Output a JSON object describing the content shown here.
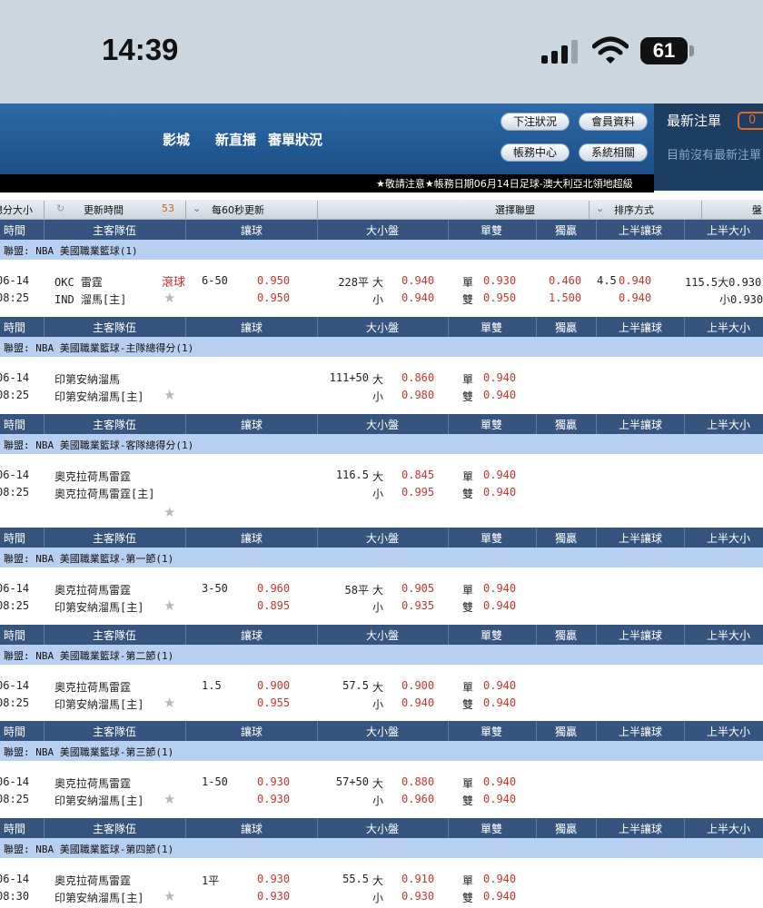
{
  "status_bar": {
    "time": "14:39",
    "battery": "61",
    "signal_icon": "cellular-signal-icon",
    "wifi_icon": "wifi-icon"
  },
  "header": {
    "nav": [
      "影城",
      "新直播",
      "審單狀況"
    ],
    "buttons": {
      "bet_status": "下注狀況",
      "member_info": "會員資料",
      "account_center": "帳務中心",
      "system": "系統相關"
    },
    "latest_bets_title": "最新注單",
    "latest_bets_count": "0",
    "latest_bets_empty": "目前沒有最新注單"
  },
  "marquee": "★敬請注意★帳務日期06月14日足球-澳大利亞北領地超級",
  "toolbar": {
    "size_filter": "總分大小",
    "refresh": "更新時間",
    "refresh_countdown": "53",
    "auto_refresh": "每60秒更新",
    "select_league": "選擇聯盟",
    "sort": "排序方式",
    "last": "盤"
  },
  "columns": [
    "時間",
    "主客隊伍",
    "讓球",
    "大小盤",
    "單雙",
    "獨贏",
    "上半讓球",
    "上半大小"
  ],
  "leagues": [
    {
      "league": "聯盟: NBA 美國職業籃球(1)",
      "date": "06-14",
      "time": "08:25",
      "home": "OKC 雷霆",
      "away": "IND 溜馬[主]",
      "live": "滾球",
      "hcap_line": "6-50",
      "hcap_home": "0.950",
      "hcap_away": "0.950",
      "ou_line": "228平",
      "over_label": "大",
      "over_odds": "0.940",
      "under_label": "小",
      "under_odds": "0.940",
      "odd_label": "單",
      "odd_odds": "0.930",
      "even_label": "雙",
      "even_odds": "0.950",
      "ml_home": "0.460",
      "ml_away": "1.500",
      "h1_hcap_line": "4.5",
      "h1_hcap_home": "0.940",
      "h1_hcap_away": "0.940",
      "h1_ou_over": "115.5大0.930",
      "h1_ou_under": "小0.930"
    },
    {
      "league": "聯盟: NBA 美國職業籃球-主隊總得分(1)",
      "date": "06-14",
      "time": "08:25",
      "home": "印第安納溜馬",
      "away": "印第安納溜馬[主]",
      "ou_line": "111+50",
      "over_label": "大",
      "over_odds": "0.860",
      "under_label": "小",
      "under_odds": "0.980",
      "odd_label": "單",
      "odd_odds": "0.940",
      "even_label": "雙",
      "even_odds": "0.940"
    },
    {
      "league": "聯盟: NBA 美國職業籃球-客隊總得分(1)",
      "date": "06-14",
      "time": "08:25",
      "home": "奧克拉荷馬雷霆",
      "away": "奧克拉荷馬雷霆[主]",
      "ou_line": "116.5",
      "over_label": "大",
      "over_odds": "0.845",
      "under_label": "小",
      "under_odds": "0.995",
      "odd_label": "單",
      "odd_odds": "0.940",
      "even_label": "雙",
      "even_odds": "0.940"
    },
    {
      "league": "聯盟: NBA 美國職業籃球-第一節(1)",
      "date": "06-14",
      "time": "08:25",
      "home": "奧克拉荷馬雷霆",
      "away": "印第安納溜馬[主]",
      "hcap_line": "3-50",
      "hcap_home": "0.960",
      "hcap_away": "0.895",
      "ou_line": "58平",
      "over_label": "大",
      "over_odds": "0.905",
      "under_label": "小",
      "under_odds": "0.935",
      "odd_label": "單",
      "odd_odds": "0.940",
      "even_label": "雙",
      "even_odds": "0.940"
    },
    {
      "league": "聯盟: NBA 美國職業籃球-第二節(1)",
      "date": "06-14",
      "time": "08:25",
      "home": "奧克拉荷馬雷霆",
      "away": "印第安納溜馬[主]",
      "hcap_line": "1.5",
      "hcap_home": "0.900",
      "hcap_away": "0.955",
      "ou_line": "57.5",
      "over_label": "大",
      "over_odds": "0.900",
      "under_label": "小",
      "under_odds": "0.940",
      "odd_label": "單",
      "odd_odds": "0.940",
      "even_label": "雙",
      "even_odds": "0.940"
    },
    {
      "league": "聯盟: NBA 美國職業籃球-第三節(1)",
      "date": "06-14",
      "time": "08:25",
      "home": "奧克拉荷馬雷霆",
      "away": "印第安納溜馬[主]",
      "hcap_line": "1-50",
      "hcap_home": "0.930",
      "hcap_away": "0.930",
      "ou_line": "57+50",
      "over_label": "大",
      "over_odds": "0.880",
      "under_label": "小",
      "under_odds": "0.960",
      "odd_label": "單",
      "odd_odds": "0.940",
      "even_label": "雙",
      "even_odds": "0.940"
    },
    {
      "league": "聯盟: NBA 美國職業籃球-第四節(1)",
      "date": "06-14",
      "time": "08:30",
      "home": "奧克拉荷馬雷霆",
      "away": "印第安納溜馬[主]",
      "hcap_line": "1平",
      "hcap_home": "0.930",
      "hcap_away": "0.930",
      "ou_line": "55.5",
      "over_label": "大",
      "over_odds": "0.910",
      "under_label": "小",
      "under_odds": "0.930",
      "odd_label": "單",
      "odd_odds": "0.940",
      "even_label": "雙",
      "even_odds": "0.940"
    }
  ]
}
